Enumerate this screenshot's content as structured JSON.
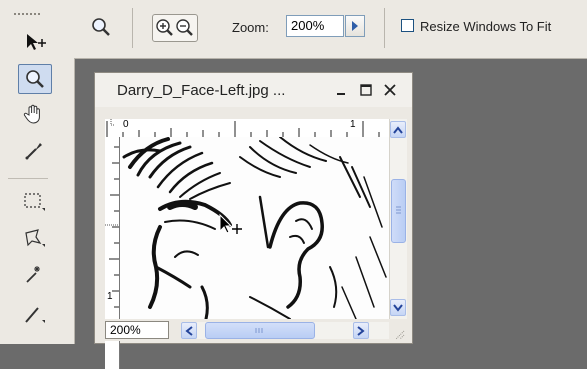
{
  "options_bar": {
    "zoom_label": "Zoom:",
    "zoom_value": "200%",
    "resize_label": "Resize Windows To Fit",
    "resize_checked": false
  },
  "document": {
    "title": "Darry_D_Face-Left.jpg ...",
    "ruler_top_marks": [
      "0",
      "1"
    ],
    "ruler_left_marks": [
      "1"
    ],
    "zoom_status": "200%"
  },
  "tools": [
    "move-tool",
    "zoom-tool",
    "hand-tool",
    "eyedropper-tool",
    "marquee-tool",
    "lasso-tool",
    "magic-wand-tool",
    "brush-tool"
  ],
  "colors": {
    "workspace": "#6b6b6b",
    "panel": "#ece9e3",
    "scroll_accent": "#b9cdf4"
  }
}
